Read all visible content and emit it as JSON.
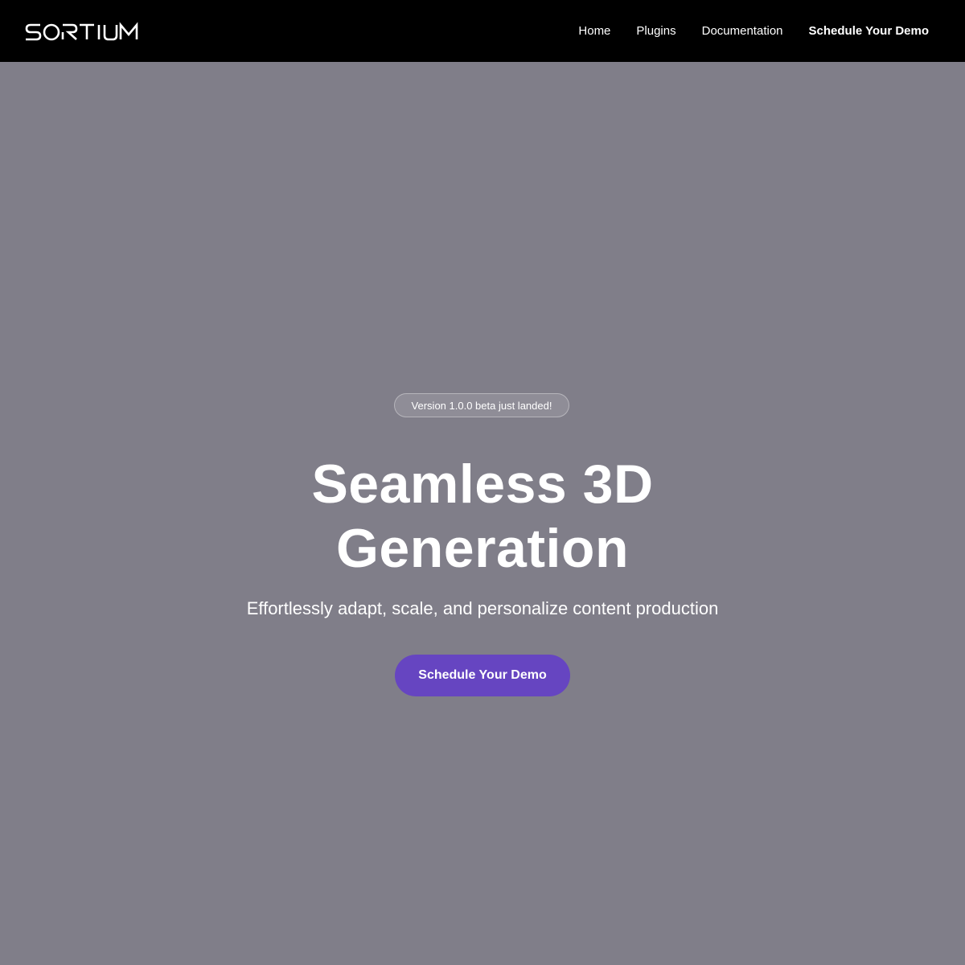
{
  "brand": {
    "logo_text": "SORTIUM"
  },
  "nav": {
    "links": [
      {
        "label": "Home"
      },
      {
        "label": "Plugins"
      },
      {
        "label": "Documentation"
      },
      {
        "label": "Schedule Your Demo"
      }
    ]
  },
  "hero": {
    "badge": "Version 1.0.0 beta just landed!",
    "headline_line1": "Seamless 3D",
    "headline_line2": "Generation",
    "subheadline": "Effortlessly adapt, scale, and personalize content production",
    "cta_label": "Schedule Your Demo"
  },
  "colors": {
    "nav_background": "#000000",
    "hero_background": "#807e89",
    "cta_background": "#6645c1",
    "text": "#ffffff"
  }
}
